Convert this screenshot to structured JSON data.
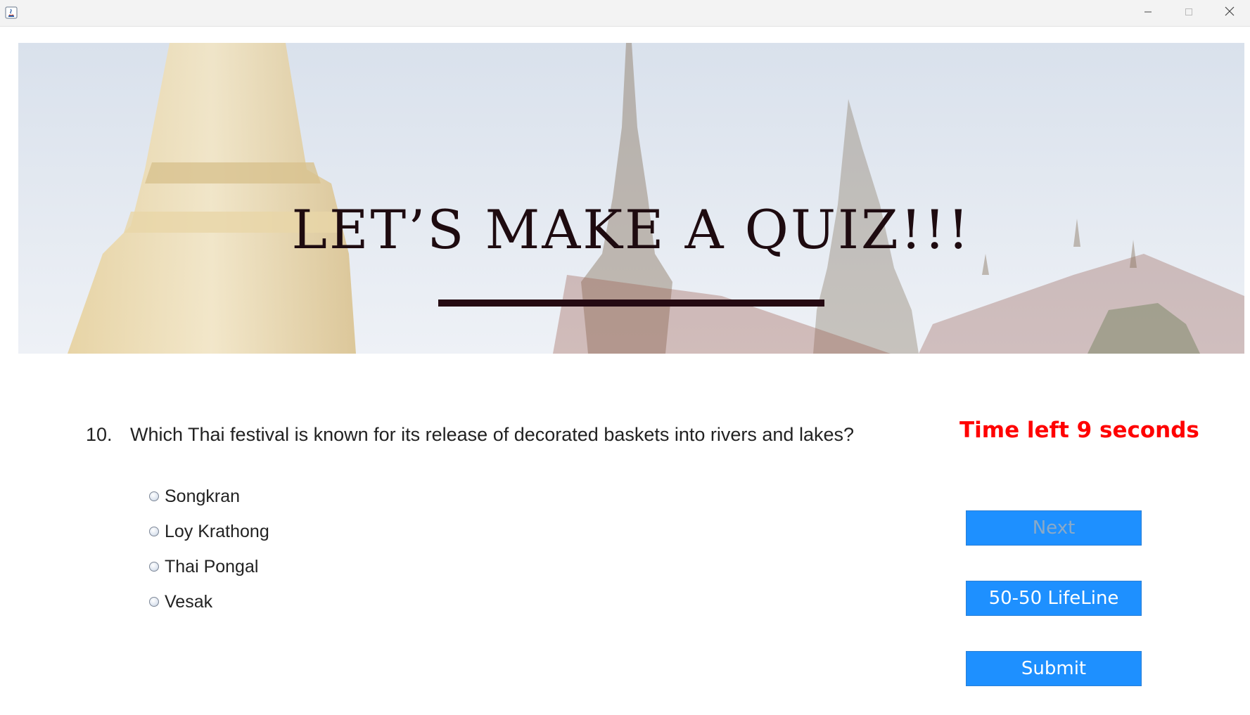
{
  "window": {
    "icon": "java-app-icon",
    "controls": [
      "minimize-icon",
      "maximize-icon",
      "close-icon"
    ]
  },
  "banner": {
    "title": "LET’S MAKE A QUIZ!!!",
    "image": "grand-palace-temple-background"
  },
  "question": {
    "number": "10.",
    "text": "Which Thai festival is known for its release of decorated baskets into rivers and lakes?"
  },
  "options": [
    {
      "label": "Songkran",
      "selected": false
    },
    {
      "label": "Loy Krathong",
      "selected": false
    },
    {
      "label": "Thai Pongal",
      "selected": false
    },
    {
      "label": "Vesak",
      "selected": false
    }
  ],
  "timer": {
    "text": "Time left 9 seconds",
    "color": "#ff0000"
  },
  "buttons": {
    "next": {
      "label": "Next",
      "enabled": false
    },
    "lifeline": {
      "label": "50-50 LifeLine",
      "enabled": true
    },
    "submit": {
      "label": "Submit",
      "enabled": true
    }
  },
  "colors": {
    "button_bg": "#1e90ff",
    "title": "#1e0b10",
    "text": "#222222"
  }
}
